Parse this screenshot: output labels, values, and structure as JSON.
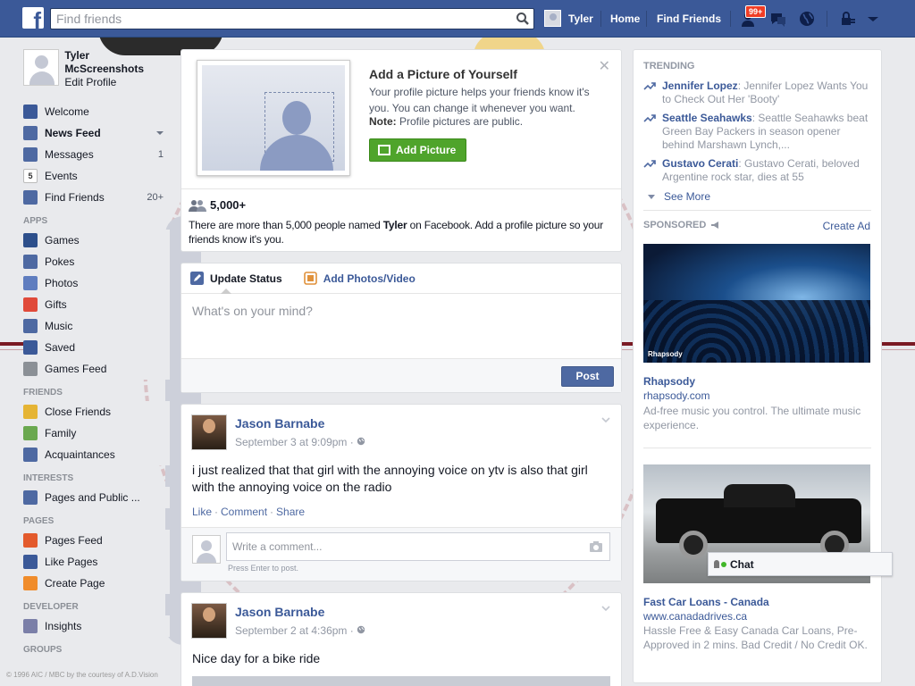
{
  "topbar": {
    "logo_letter": "f",
    "search_placeholder": "Find friends",
    "user_name": "Tyler",
    "home_label": "Home",
    "find_friends_label": "Find Friends",
    "friend_requests_badge": "99+"
  },
  "profile": {
    "name": "Tyler McScreenshots",
    "edit_label": "Edit Profile"
  },
  "nav": {
    "favorites": [
      {
        "label": "Welcome",
        "icon": "facebook-icon",
        "color": "#3b5998"
      },
      {
        "label": "News Feed",
        "icon": "news-feed-icon",
        "color": "#4e69a2",
        "bold": true
      },
      {
        "label": "Messages",
        "icon": "messages-icon",
        "color": "#4e69a2",
        "count": "1"
      },
      {
        "label": "Events",
        "icon": "calendar-icon",
        "color": "#d34a3a",
        "glyph": "5"
      },
      {
        "label": "Find Friends",
        "icon": "find-friends-icon",
        "color": "#4e69a2",
        "count": "20+"
      }
    ],
    "apps_heading": "APPS",
    "apps": [
      {
        "label": "Games",
        "icon": "games-icon",
        "color": "#2d4f8b"
      },
      {
        "label": "Pokes",
        "icon": "pokes-icon",
        "color": "#4e69a2"
      },
      {
        "label": "Photos",
        "icon": "photos-icon",
        "color": "#5f7dbf"
      },
      {
        "label": "Gifts",
        "icon": "gifts-icon",
        "color": "#e04a3a"
      },
      {
        "label": "Music",
        "icon": "music-icon",
        "color": "#4e69a2"
      },
      {
        "label": "Saved",
        "icon": "saved-icon",
        "color": "#3b5998"
      },
      {
        "label": "Games Feed",
        "icon": "games-feed-icon",
        "color": "#8b9096"
      }
    ],
    "friends_heading": "FRIENDS",
    "friends": [
      {
        "label": "Close Friends",
        "icon": "star-icon",
        "color": "#e5b434"
      },
      {
        "label": "Family",
        "icon": "family-icon",
        "color": "#6aa84f"
      },
      {
        "label": "Acquaintances",
        "icon": "acquaintances-icon",
        "color": "#4e69a2"
      }
    ],
    "interests_heading": "INTERESTS",
    "interests": [
      {
        "label": "Pages and Public ...",
        "icon": "pages-public-icon",
        "color": "#4e69a2"
      }
    ],
    "pages_heading": "PAGES",
    "pages": [
      {
        "label": "Pages Feed",
        "icon": "pages-feed-icon",
        "color": "#e35a2c"
      },
      {
        "label": "Like Pages",
        "icon": "like-icon",
        "color": "#3b5998"
      },
      {
        "label": "Create Page",
        "icon": "create-page-icon",
        "color": "#f08c2b"
      }
    ],
    "developer_heading": "DEVELOPER",
    "developer": [
      {
        "label": "Insights",
        "icon": "insights-icon",
        "color": "#7b7fa8"
      }
    ],
    "groups_heading": "GROUPS"
  },
  "copyright": "© 1996 AIC / MBC by the courtesy of A.D.Vision",
  "add_picture": {
    "title": "Add a Picture of Yourself",
    "desc": "Your profile picture helps your friends know it's you. You can change it whenever you want.",
    "note_label": "Note:",
    "note_text": " Profile pictures are public.",
    "button": "Add Picture",
    "count": "5,000+",
    "more_pre": "There are more than 5,000 people named ",
    "more_name": "Tyler",
    "more_post": " on Facebook. Add a profile picture so your friends know it's you."
  },
  "composer": {
    "tab_status": "Update Status",
    "tab_photos": "Add Photos/Video",
    "placeholder": "What's on your mind?",
    "post_button": "Post"
  },
  "posts": [
    {
      "author": "Jason Barnabe",
      "time": "September 3 at 9:09pm · ",
      "text": "i just realized that that girl with the annoying voice on ytv is also that girl with the annoying voice on the radio",
      "like": "Like",
      "comment": "Comment",
      "share": "Share",
      "comment_placeholder": "Write a comment...",
      "hint": "Press Enter to post."
    },
    {
      "author": "Jason Barnabe",
      "time": "September 2 at 4:36pm · ",
      "text": "Nice day for a bike ride"
    }
  ],
  "right": {
    "trending_heading": "TRENDING",
    "trending": [
      {
        "name": "Jennifer Lopez",
        "text": ": Jennifer Lopez Wants You to Check Out Her 'Booty'"
      },
      {
        "name": "Seattle Seahawks",
        "text": ": Seattle Seahawks beat Green Bay Packers in season opener behind Marshawn Lynch,..."
      },
      {
        "name": "Gustavo Cerati",
        "text": ": Gustavo Cerati, beloved Argentine rock star, dies at 55"
      }
    ],
    "see_more": "See More",
    "sponsored_heading": "SPONSORED",
    "create_ad": "Create Ad",
    "ads": [
      {
        "brand_mark": "Rhapsody",
        "title": "Rhapsody",
        "url": "rhapsody.com",
        "desc": "Ad-free music you control. The ultimate music experience."
      },
      {
        "title": "Fast Car Loans - Canada",
        "url": "www.canadadrives.ca",
        "desc": "Hassle Free & Easy Canada Car Loans, Pre-Approved in 2 mins. Bad Credit / No Credit OK."
      }
    ]
  },
  "chat": {
    "label": "Chat"
  }
}
